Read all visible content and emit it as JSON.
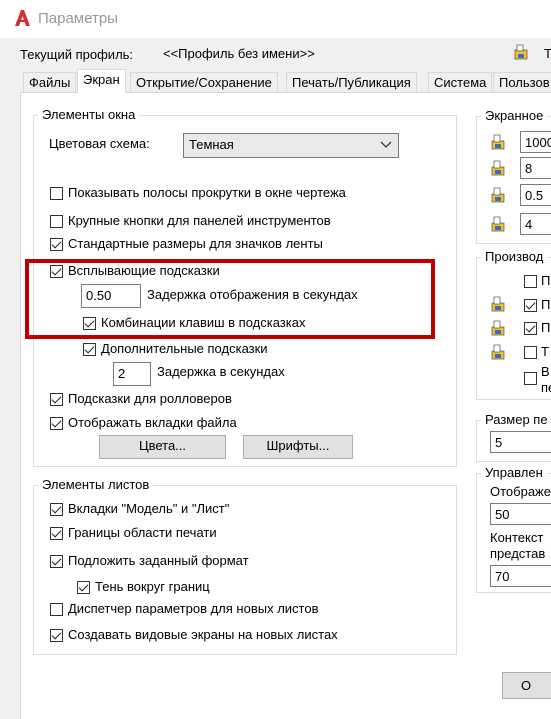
{
  "window": {
    "title": "Параметры"
  },
  "profile": {
    "label": "Текущий профиль:",
    "value": "<<Профиль без имени>>",
    "right_text": "Т"
  },
  "tabs": [
    {
      "label": "Файлы"
    },
    {
      "label": "Экран"
    },
    {
      "label": "Открытие/Сохранение"
    },
    {
      "label": "Печать/Публикация"
    },
    {
      "label": "Система"
    },
    {
      "label": "Пользов"
    }
  ],
  "window_elements": {
    "title": "Элементы окна",
    "color_scheme_label": "Цветовая схема:",
    "color_scheme_value": "Темная",
    "items": [
      {
        "label": "Показывать полосы прокрутки в окне чертежа",
        "checked": false
      },
      {
        "label": "Крупные кнопки для панелей инструментов",
        "checked": false
      },
      {
        "label": "Стандартные размеры для значков ленты",
        "checked": true
      },
      {
        "label": "Всплывающие подсказки",
        "checked": true
      }
    ],
    "tooltip_delay_value": "0.50",
    "tooltip_delay_label": "Задержка отображения в секундах",
    "shortcut_label": "Комбинации клавиш в подсказках",
    "extended_label": "Дополнительные подсказки",
    "extended_delay_value": "2",
    "extended_delay_label": "Задержка в секундах",
    "rollover_label": "Подсказки для ролловеров",
    "file_tabs_label": "Отображать вкладки файла",
    "colors_button": "Цвета...",
    "fonts_button": "Шрифты..."
  },
  "layout_elements": {
    "title": "Элементы листов",
    "items": [
      {
        "label": "Вкладки \"Модель\" и \"Лист\"",
        "checked": true
      },
      {
        "label": "Границы области печати",
        "checked": true
      },
      {
        "label": "Подложить заданный формат",
        "checked": true
      },
      {
        "label": "Тень вокруг границ",
        "checked": true
      },
      {
        "label": "Диспетчер параметров для новых листов",
        "checked": false
      },
      {
        "label": "Создавать видовые экраны на новых листах",
        "checked": true
      }
    ]
  },
  "right": {
    "resolution_title": "Экранное",
    "resolution_values": [
      "1000",
      "8",
      "0.5",
      "4"
    ],
    "performance_title": "Производ",
    "perf_items": [
      {
        "label": "П",
        "checked": false
      },
      {
        "label": "П",
        "checked": true
      },
      {
        "label": "П",
        "checked": true
      },
      {
        "label": "Т",
        "checked": false
      },
      {
        "label": "В",
        "checked": false
      }
    ],
    "perf_extra": "пе",
    "size_title": "Размер пе",
    "size_value": "5",
    "control_title": "Управлен",
    "display_label": "Отображе",
    "display_value": "50",
    "context_label": "Контекст",
    "context_label2": "представ",
    "context_value": "70",
    "ok_button": "O"
  },
  "colors": {
    "accent": "#c00000",
    "logo": "#d32f2f"
  }
}
